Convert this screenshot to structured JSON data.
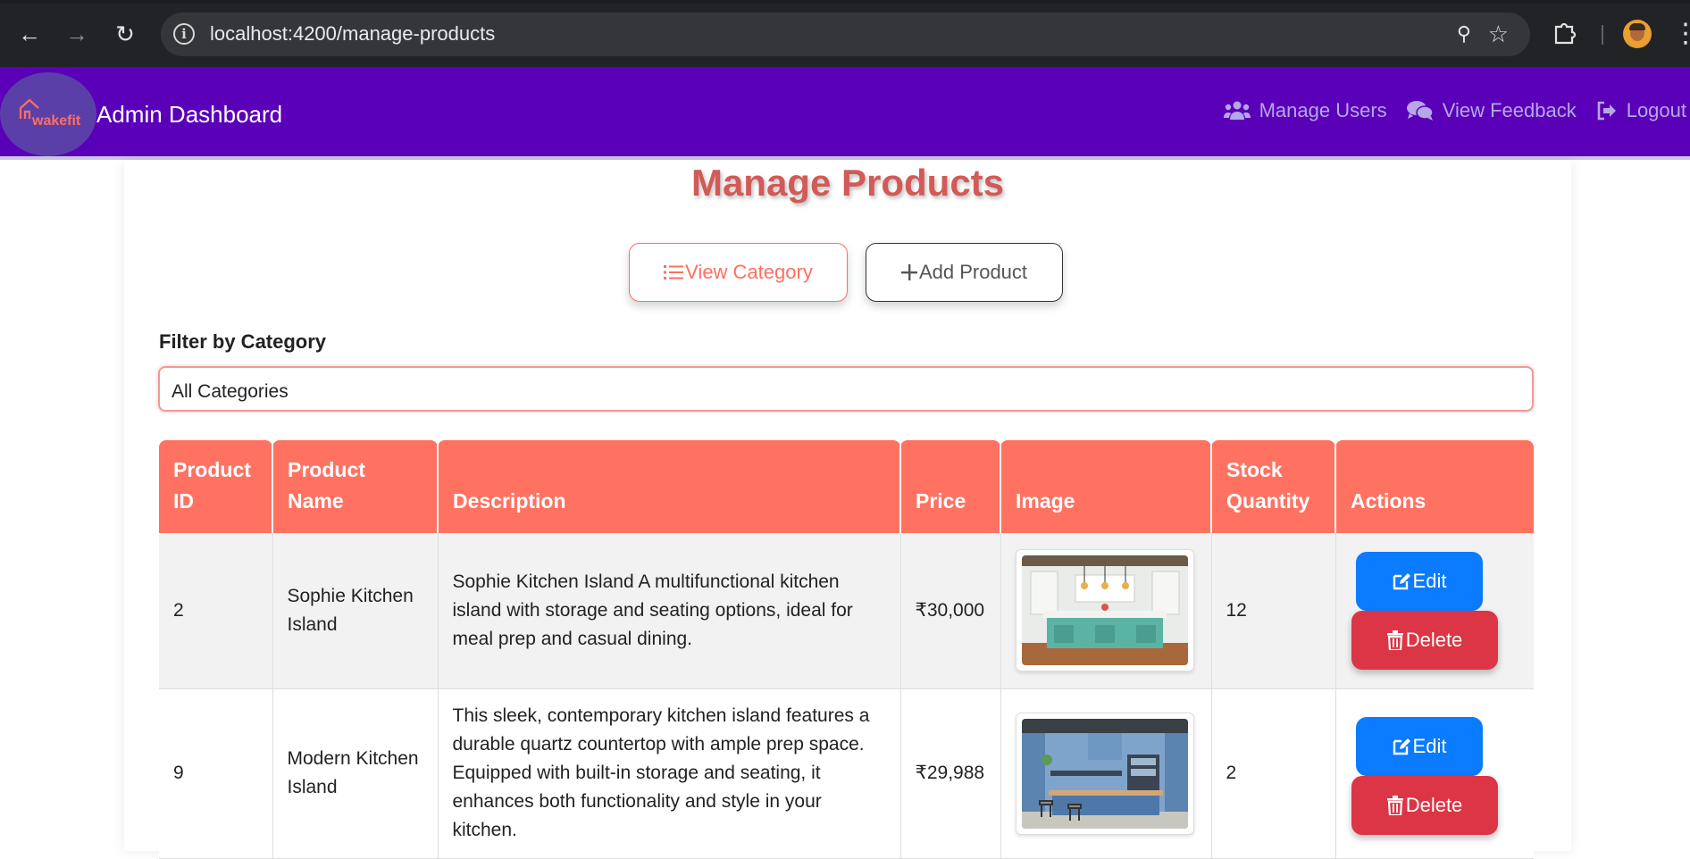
{
  "browser": {
    "url_host": "localhost",
    "url_rest": ":4200/manage-products",
    "icons": [
      "back-arrow-icon",
      "forward-arrow-icon",
      "reload-icon",
      "info-icon",
      "zoom-icon",
      "star-icon",
      "extensions-icon",
      "profile-avatar",
      "more-icon"
    ]
  },
  "header": {
    "logo_text": "wakefit",
    "title": "Admin Dashboard",
    "nav": [
      {
        "label": "Manage Users",
        "icon": "users-icon"
      },
      {
        "label": "View Feedback",
        "icon": "comments-icon"
      },
      {
        "label": "Logout",
        "icon": "logout-icon"
      }
    ],
    "bg_color": "#5a00b8"
  },
  "main": {
    "title": "Manage Products",
    "view_category_label": "View Category",
    "add_product_label": "Add Product",
    "filter_label": "Filter by Category",
    "filter_value": "All Categories",
    "accent_color": "#ff7262"
  },
  "table": {
    "columns": [
      "Product ID",
      "Product Name",
      "Description",
      "Price",
      "Image",
      "Stock Quantity",
      "Actions"
    ],
    "rows": [
      {
        "id": "2",
        "name": "Sophie Kitchen Island",
        "description": "Sophie Kitchen Island A multifunctional kitchen island with storage and seating options, ideal for meal prep and casual dining.",
        "price": "₹30,000",
        "stock": "12",
        "edit_label": "Edit",
        "delete_label": "Delete"
      },
      {
        "id": "9",
        "name": "Modern Kitchen Island",
        "description": "This sleek, contemporary kitchen island features a durable quartz countertop with ample prep space. Equipped with built-in storage and seating, it enhances both functionality and style in your kitchen.",
        "price": "₹29,988",
        "stock": "2",
        "edit_label": "Edit",
        "delete_label": "Delete"
      }
    ]
  }
}
